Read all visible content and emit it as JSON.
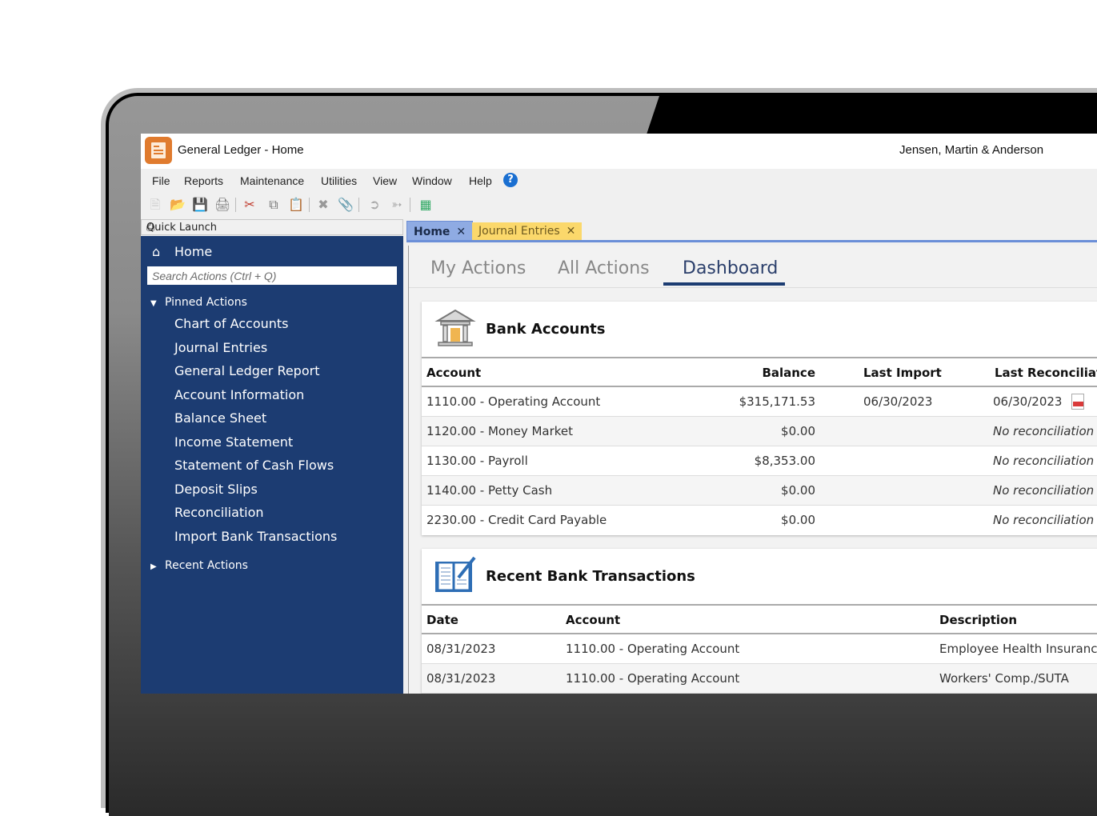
{
  "window": {
    "title": "General Ledger - Home",
    "company": "Jensen, Martin & Anderson"
  },
  "menu": [
    "File",
    "Reports",
    "Maintenance",
    "Utilities",
    "View",
    "Window",
    "Help"
  ],
  "toolbar": [
    "new-icon",
    "open-icon",
    "save-icon",
    "print-icon",
    "cut-icon",
    "copy-icon",
    "paste-icon",
    "delete-icon",
    "attach-icon",
    "back-icon",
    "forward-icon",
    "calculator-icon"
  ],
  "quick_launch": {
    "header": "Quick Launch",
    "home": "Home",
    "search_placeholder": "Search Actions (Ctrl + Q)",
    "pinned_label": "Pinned Actions",
    "pinned": [
      "Chart of Accounts",
      "Journal Entries",
      "General Ledger Report",
      "Account Information",
      "Balance Sheet",
      "Income Statement",
      "Statement of Cash Flows",
      "Deposit Slips",
      "Reconciliation",
      "Import Bank Transactions"
    ],
    "recent_label": "Recent Actions"
  },
  "doc_tabs": [
    {
      "label": "Home",
      "active": true
    },
    {
      "label": "Journal Entries",
      "active": false
    }
  ],
  "sub_tabs": [
    "My Actions",
    "All Actions",
    "Dashboard"
  ],
  "active_sub_tab": "Dashboard",
  "bank_accounts": {
    "title": "Bank Accounts",
    "columns": [
      "Account",
      "Balance",
      "Last Import",
      "Last Reconciliatio"
    ],
    "rows": [
      {
        "account": "1110.00 - Operating Account",
        "balance": "$315,171.53",
        "last_import": "06/30/2023",
        "last_recon": "06/30/2023",
        "pdf": true
      },
      {
        "account": "1120.00 - Money Market",
        "balance": "$0.00",
        "last_import": "",
        "last_recon": "No reconciliation h",
        "pdf": false
      },
      {
        "account": "1130.00 - Payroll",
        "balance": "$8,353.00",
        "last_import": "",
        "last_recon": "No reconciliation h",
        "pdf": false
      },
      {
        "account": "1140.00 - Petty Cash",
        "balance": "$0.00",
        "last_import": "",
        "last_recon": "No reconciliation h",
        "pdf": false
      },
      {
        "account": "2230.00 - Credit Card Payable",
        "balance": "$0.00",
        "last_import": "",
        "last_recon": "No reconciliation h",
        "pdf": false
      }
    ]
  },
  "recent_transactions": {
    "title": "Recent Bank Transactions",
    "columns": [
      "Date",
      "Account",
      "Description"
    ],
    "rows": [
      {
        "date": "08/31/2023",
        "account": "1110.00 - Operating Account",
        "description": "Employee Health Insurance"
      },
      {
        "date": "08/31/2023",
        "account": "1110.00 - Operating Account",
        "description": "Workers' Comp./SUTA"
      }
    ]
  },
  "colors": {
    "sidebar": "#1c3c72",
    "app_icon": "#e07b2e",
    "active_tab": "#8fabe3",
    "journal_tab": "#fbd86b"
  }
}
